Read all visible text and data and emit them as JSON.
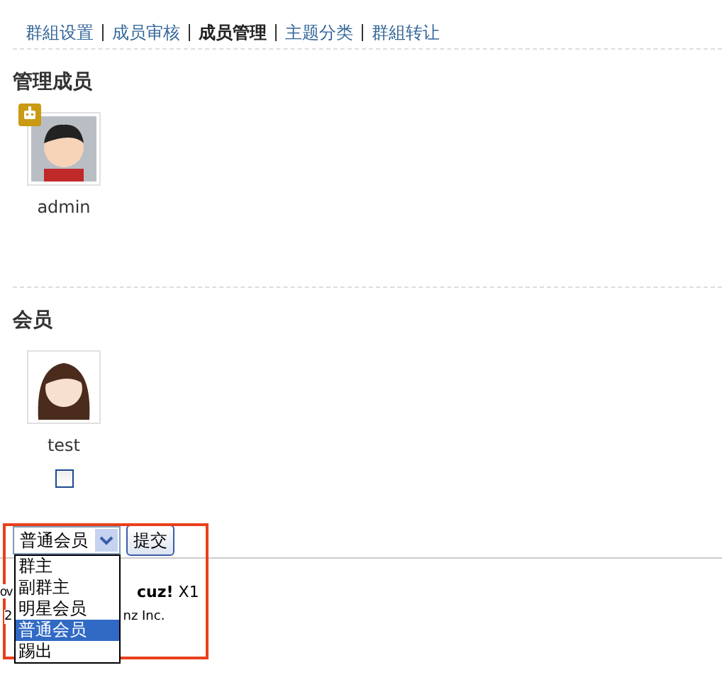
{
  "nav": [
    {
      "label": "群組设置",
      "selected": false
    },
    {
      "label": "成员审核",
      "selected": false
    },
    {
      "label": "成员管理",
      "selected": true
    },
    {
      "label": "主题分类",
      "selected": false
    },
    {
      "label": "群組转让",
      "selected": false
    }
  ],
  "sections": [
    {
      "title": "管理成员",
      "members": [
        {
          "name": "admin",
          "badge": true,
          "kind": "boy"
        }
      ]
    },
    {
      "title": "会员",
      "members": [
        {
          "name": "test",
          "badge": false,
          "kind": "girl",
          "checkbox": {
            "checked": false
          }
        }
      ]
    }
  ],
  "role_select": {
    "value": "普通会员",
    "options": [
      {
        "label": "群主",
        "selected": false
      },
      {
        "label": "副群主",
        "selected": false
      },
      {
        "label": "明星会员",
        "selected": false
      },
      {
        "label": "普通会员",
        "selected": true
      },
      {
        "label": "踢出",
        "selected": false
      }
    ]
  },
  "submit_button": "提交",
  "footer": [
    [
      "ov",
      "**cuz!** X1"
    ],
    [
      "2",
      "nz Inc."
    ]
  ]
}
